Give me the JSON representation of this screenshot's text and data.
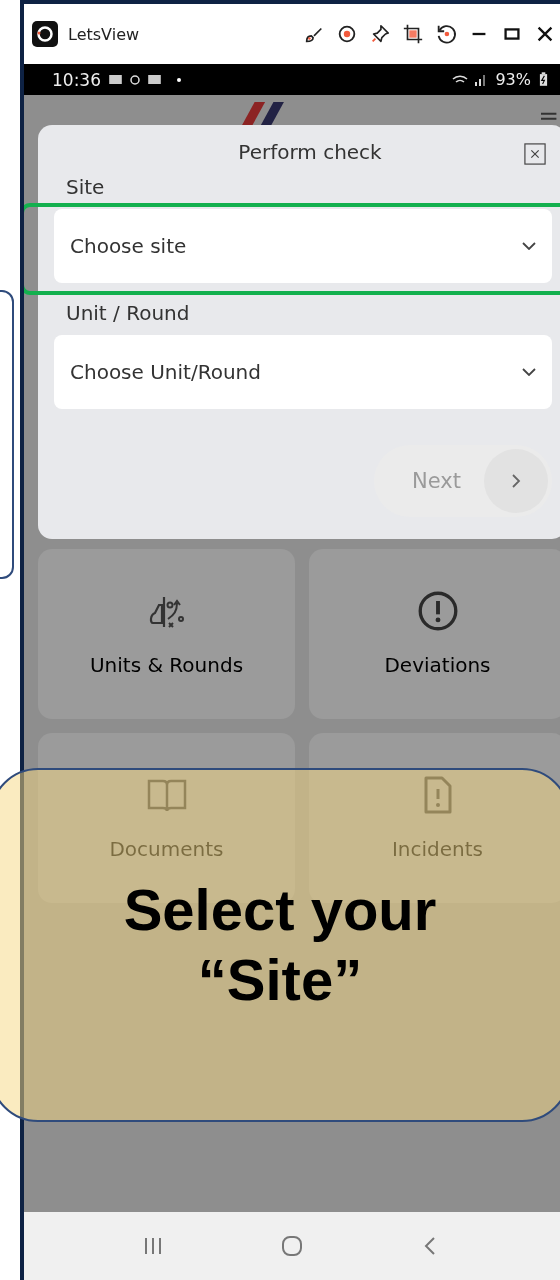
{
  "window": {
    "title": "LetsView"
  },
  "status_bar": {
    "time": "10:36",
    "battery": "93%"
  },
  "dialog": {
    "title": "Perform check",
    "fields": [
      {
        "label": "Site",
        "placeholder": "Choose site",
        "highlighted": true
      },
      {
        "label": "Unit / Round",
        "placeholder": "Choose Unit/Round",
        "highlighted": false
      }
    ],
    "next_button": {
      "label": "Next",
      "disabled": true
    }
  },
  "tiles": [
    {
      "kind": "units",
      "label": "Units & Rounds"
    },
    {
      "kind": "deviations",
      "label": "Deviations"
    },
    {
      "kind": "documents",
      "label": "Documents"
    },
    {
      "kind": "incidents",
      "label": "Incidents"
    }
  ],
  "callout": {
    "text": "Select your “Site”"
  }
}
